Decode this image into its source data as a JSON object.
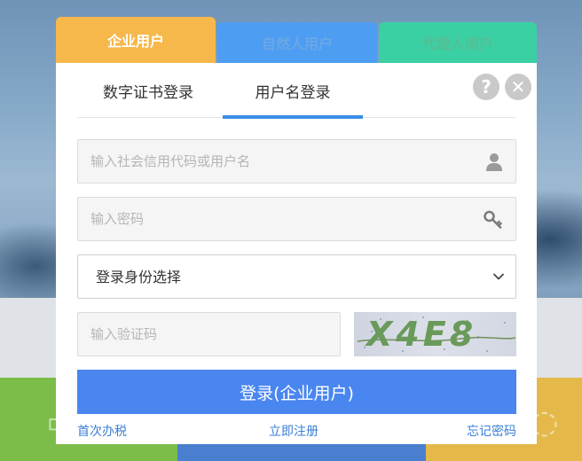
{
  "tabs": {
    "company": "企业用户",
    "natural": "自然人用户",
    "agent": "代理人用户"
  },
  "subtabs": {
    "cert": "数字证书登录",
    "username": "用户名登录"
  },
  "icons": {
    "help": "?",
    "close": "✕"
  },
  "form": {
    "username_placeholder": "输入社会信用代码或用户名",
    "password_placeholder": "输入密码",
    "identity_selected": "登录身份选择",
    "captcha_placeholder": "输入验证码",
    "captcha_text": "X4E8"
  },
  "login_button": "登录(企业用户)",
  "links": {
    "first_time": "首次办税",
    "register": "立即注册",
    "forgot": "忘记密码"
  },
  "colors": {
    "tab_company": "#f7b84b",
    "tab_natural": "#4d9df2",
    "tab_agent": "#3bd0a4",
    "primary": "#4a86f0",
    "active_underline": "#3a8ee6",
    "link": "#3a7fd5"
  }
}
